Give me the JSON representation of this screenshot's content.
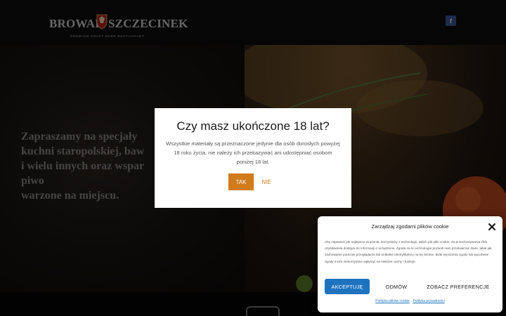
{
  "header": {
    "logo_left": "BROWAR",
    "logo_right": "SZCZECINEK",
    "logo_tagline": "PREMIUM CRAFT BEER RESTAURANT",
    "facebook_label": "f"
  },
  "hero": {
    "text": "Zapraszamy na specjały\nkuchni staropolskiej, baw\ni wielu innych oraz wspar\npiwo\nwarzone na miejscu."
  },
  "age_gate": {
    "title": "Czy masz ukończone 18 lat?",
    "text": "Wszystkie materiały są przeznaczone jedynie dla osób dorosłych powyżej 18 roku życia, nie należy ich przekazywać ani udostępniać osobom poniżej 18 lat.",
    "yes_label": "TAK",
    "no_label": "NIE"
  },
  "cookie_banner": {
    "title": "Zarządzaj zgodami plików cookie",
    "text": "Aby zapewnić jak najlepsze wrażenia, korzystamy z technologii, takich jak pliki cookie, do przechowywania i/lub uzyskiwania dostępu do informacji o urządzeniu. Zgoda na te technologie pozwoli nam przetwarzać dane, takie jak zachowanie podczas przeglądania lub unikalne identyfikatory na tej stronie. Brak wyrażenia zgody lub wycofanie zgody może niekorzystnie wpłynąć na niektóre cechy i funkcje.",
    "accept_label": "AKCEPTUJĘ",
    "deny_label": "ODMÓW",
    "prefs_label": "ZOBACZ PREFERENCJE",
    "link_cookie_policy": "Polityka plików cookie",
    "link_separator": "-",
    "link_privacy_policy": "Polityka prywatności",
    "accent_color": "#1e73be"
  },
  "colors": {
    "age_button": "#d17a1c",
    "facebook": "#3b5998"
  }
}
